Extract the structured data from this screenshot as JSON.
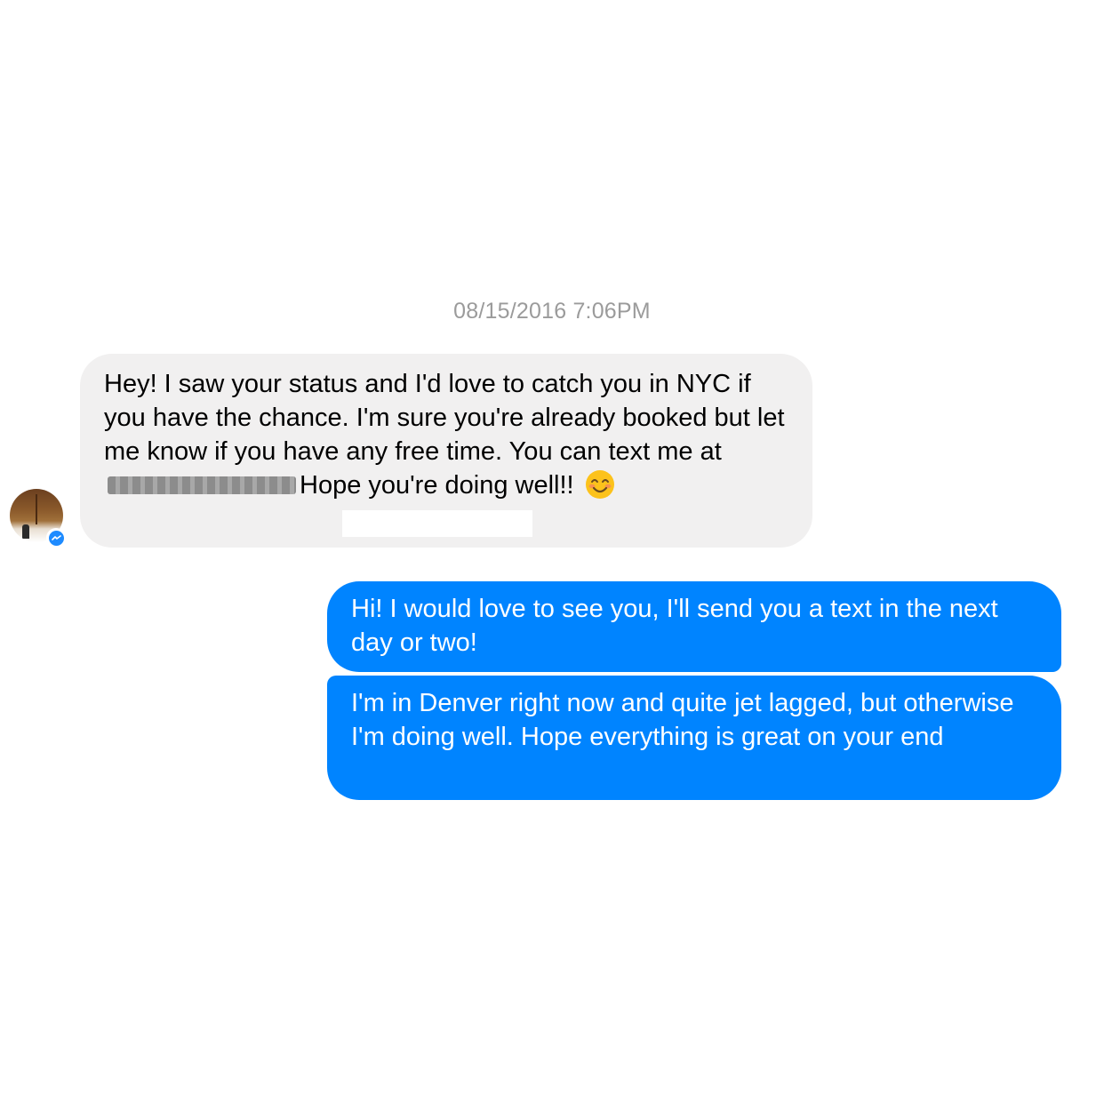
{
  "conversation": {
    "timestamp": "08/15/2016 7:06PM",
    "incoming": {
      "text_before_redaction": "Hey! I saw your status and I'd love to catch you in NYC if you have the chance. I'm sure you're already booked but let me know if you have any free time. You can text me at",
      "text_after_redaction": "Hope you're doing well!!",
      "emoji": "smiling-face-icon",
      "avatar_icon": "contact-avatar",
      "badge_icon": "messenger-icon"
    },
    "outgoing": [
      {
        "text": "Hi! I would love to see you, I'll send you a text in the next day or two!"
      },
      {
        "text": "I'm in Denver right now and quite jet lagged, but otherwise I'm doing well. Hope everything is great on your end"
      }
    ]
  },
  "colors": {
    "incoming_bubble": "#f1f0f0",
    "outgoing_bubble": "#0084ff",
    "timestamp": "#9b9b9b",
    "messenger_badge": "#1e8bff"
  }
}
